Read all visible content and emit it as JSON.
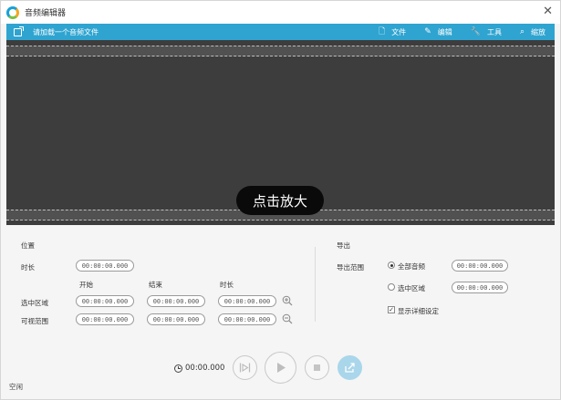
{
  "window": {
    "title": "音频编辑器",
    "close_glyph": "✕"
  },
  "toolbar": {
    "add_label": "请加载一个音频文件",
    "items": [
      {
        "icon": "file-icon",
        "glyph": "🗋",
        "label": "文件"
      },
      {
        "icon": "edit-icon",
        "glyph": "✎",
        "label": "编辑"
      },
      {
        "icon": "wrench-icon",
        "glyph": "🔧",
        "label": "工具"
      },
      {
        "icon": "search-icon",
        "glyph": "⌕",
        "label": "缩放"
      }
    ]
  },
  "waveform": {
    "zoom_hint": "点击放大"
  },
  "position": {
    "title": "位置",
    "duration_label": "时长",
    "duration_value": "00:00:00.000",
    "col_start": "开始",
    "col_end": "结束",
    "col_length": "时长",
    "selection_label": "选中区域",
    "selection_start": "00:00:00.000",
    "selection_end": "00:00:00.000",
    "selection_length": "00:00:00.000",
    "visible_label": "可视范围",
    "visible_start": "00:00:00.000",
    "visible_end": "00:00:00.000",
    "visible_length": "00:00:00.000"
  },
  "export": {
    "title": "导出",
    "range_label": "导出范围",
    "all_audio_label": "全部音频",
    "all_audio_value": "00:00:00.000",
    "selection_label": "选中区域",
    "selection_value": "00:00:00.000",
    "show_details_label": "显示详细设定",
    "show_details_checked": true
  },
  "transport": {
    "time": "00:00.000"
  },
  "status": {
    "text": "空闲"
  },
  "colors": {
    "accent": "#2fa4d0",
    "waveform_bg": "#3d3d3d"
  }
}
